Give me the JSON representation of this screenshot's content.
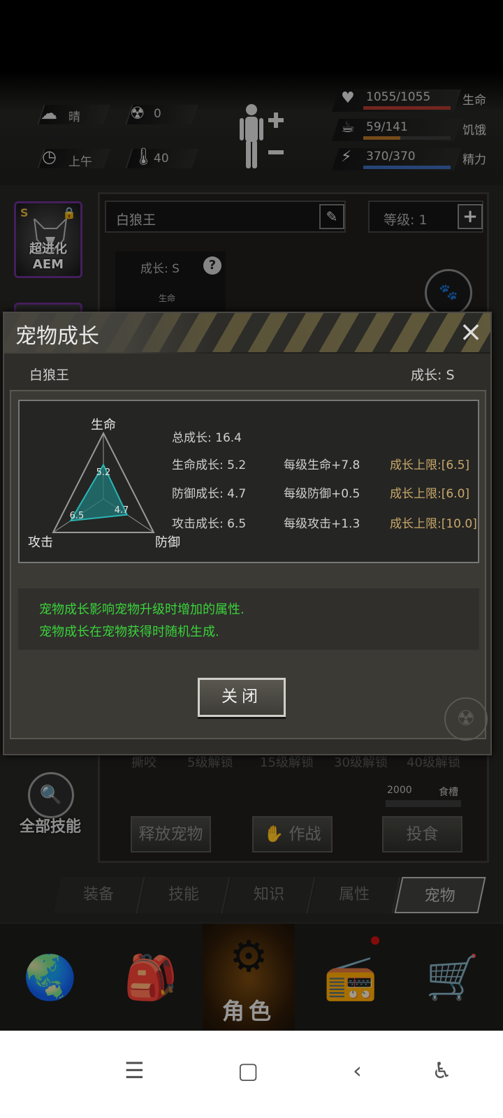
{
  "status": {
    "weather": "晴",
    "radiation": "0",
    "time_of_day": "上午",
    "temperature": "40",
    "health": {
      "text": "1055/1055",
      "label": "生命",
      "fraction": 1.0,
      "color": "#b03a2e"
    },
    "hunger": {
      "text": "59/141",
      "label": "饥饿",
      "fraction": 0.42,
      "color": "#b5742a"
    },
    "energy": {
      "text": "370/370",
      "label": "精力",
      "fraction": 1.0,
      "color": "#3b6bb5"
    }
  },
  "pet_page": {
    "pet_badge": "超进化AEM",
    "pet_badge_rank": "S",
    "name": "白狼王",
    "level": "等级:  1",
    "growth": "成长: S",
    "radar_small_label": "生命",
    "unlocks": [
      "撕咬",
      "5级解锁",
      "15级解锁",
      "30级解锁",
      "40级解锁"
    ],
    "food_value": "2000",
    "food_label": "食槽",
    "all_skills": "全部技能",
    "release_btn": "释放宠物",
    "fight_btn": "作战",
    "feed_btn": "投食"
  },
  "tabs": [
    "装备",
    "技能",
    "知识",
    "属性",
    "宠物"
  ],
  "bottom_nav": {
    "active_label": "角色"
  },
  "modal": {
    "title": "宠物成长",
    "close_icon": "×",
    "pet_name": "白狼王",
    "pet_growth": "成长: S",
    "radar_axes": {
      "top": "生命",
      "left": "攻击",
      "right": "防御"
    },
    "radar_values": {
      "life": "5.2",
      "defense": "4.7",
      "attack": "6.5"
    },
    "total_growth": "总成长:     16.4",
    "rows": [
      {
        "growth": "生命成长: 5.2",
        "per_level": "每级生命+7.8",
        "limit": "成长上限:[6.5]"
      },
      {
        "growth": "防御成长: 4.7",
        "per_level": "每级防御+0.5",
        "limit": "成长上限:[6.0]"
      },
      {
        "growth": "攻击成长: 6.5",
        "per_level": "每级攻击+1.3",
        "limit": "成长上限:[10.0]"
      }
    ],
    "info_lines": [
      "宠物成长影响宠物升级时增加的属性.",
      "宠物成长在宠物获得时随机生成."
    ],
    "close_button": "关闭"
  }
}
